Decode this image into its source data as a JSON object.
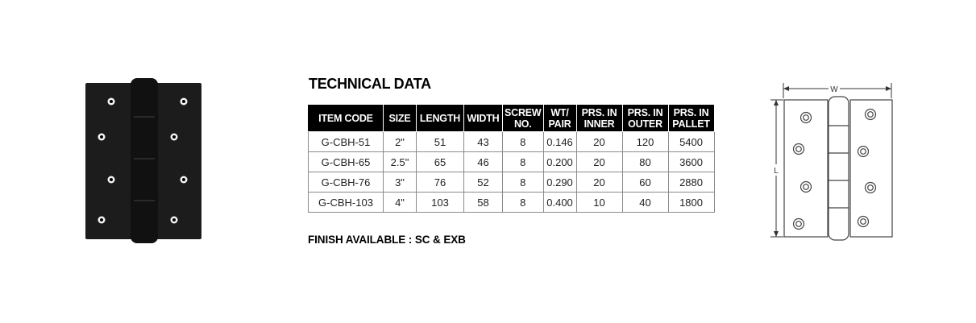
{
  "title": "TECHNICAL DATA",
  "table": {
    "headers": [
      [
        "ITEM CODE"
      ],
      [
        "SIZE"
      ],
      [
        "LENGTH"
      ],
      [
        "WIDTH"
      ],
      [
        "SCREW",
        "NO."
      ],
      [
        "WT/",
        "PAIR"
      ],
      [
        "PRS. IN",
        "INNER"
      ],
      [
        "PRS. IN",
        "OUTER"
      ],
      [
        "PRS. IN",
        "PALLET"
      ]
    ],
    "rows": [
      [
        "G-CBH-51",
        "2\"",
        "51",
        "43",
        "8",
        "0.146",
        "20",
        "120",
        "5400"
      ],
      [
        "G-CBH-65",
        "2.5\"",
        "65",
        "46",
        "8",
        "0.200",
        "20",
        "80",
        "3600"
      ],
      [
        "G-CBH-76",
        "3\"",
        "76",
        "52",
        "8",
        "0.290",
        "20",
        "60",
        "2880"
      ],
      [
        "G-CBH-103",
        "4\"",
        "103",
        "58",
        "8",
        "0.400",
        "10",
        "40",
        "1800"
      ]
    ]
  },
  "finish": "FINISH AVAILABLE : SC & EXB",
  "drawing": {
    "width_label": "W",
    "length_label": "L"
  }
}
